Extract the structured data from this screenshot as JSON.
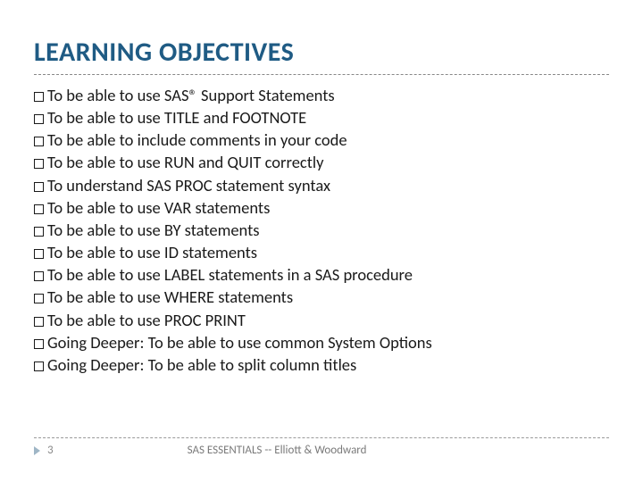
{
  "title": "LEARNING OBJECTIVES",
  "objectives": [
    "To be able to use SAS® Support Statements",
    "To be able to use TITLE and FOOTNOTE",
    "To be able to include comments in your code",
    "To be able to use RUN and QUIT correctly",
    "To understand SAS PROC statement syntax",
    "To be able to use VAR statements",
    "To be able to use BY statements",
    "To be able to use ID statements",
    "To be able to use LABEL statements in a SAS procedure",
    "To be able to use WHERE statements",
    "To be able to use PROC PRINT",
    "Going Deeper: To be able to use common System Options",
    "Going Deeper: To be able to split column titles"
  ],
  "footer": {
    "page_number": "3",
    "text": "SAS ESSENTIALS -- Elliott & Woodward"
  }
}
